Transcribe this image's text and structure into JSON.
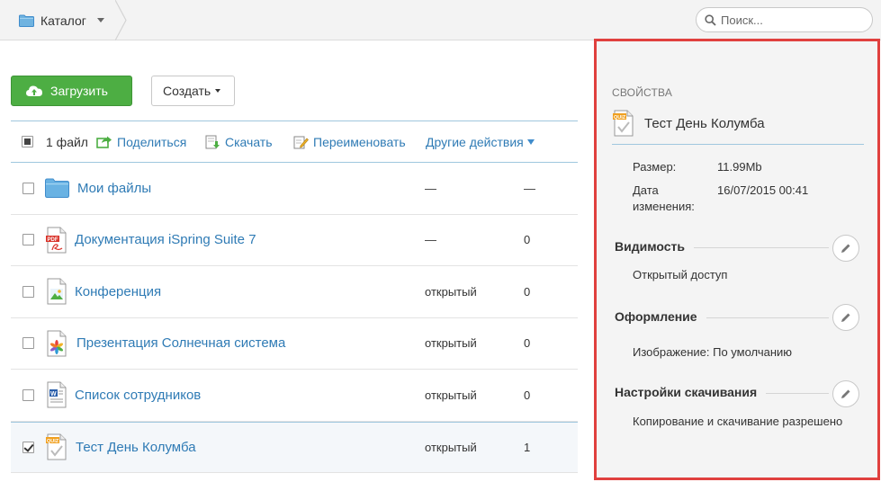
{
  "header": {
    "breadcrumb_label": "Каталог",
    "search_placeholder": "Поиск..."
  },
  "toolbar": {
    "upload_label": "Загрузить",
    "create_label": "Создать"
  },
  "list_header": {
    "count_label": "1 файл",
    "share_label": "Поделиться",
    "download_label": "Скачать",
    "rename_label": "Переименовать",
    "other_label": "Другие действия"
  },
  "files": [
    {
      "name": "Мои файлы",
      "type": "folder",
      "access": "—",
      "views": "—",
      "checked": false
    },
    {
      "name": "Документация iSpring Suite 7",
      "type": "pdf",
      "access": "—",
      "views": "0",
      "checked": false
    },
    {
      "name": "Конференция",
      "type": "image",
      "access": "открытый",
      "views": "0",
      "checked": false
    },
    {
      "name": "Презентация Солнечная система",
      "type": "presentation",
      "access": "открытый",
      "views": "0",
      "checked": false
    },
    {
      "name": "Список сотрудников",
      "type": "word",
      "access": "открытый",
      "views": "0",
      "checked": false
    },
    {
      "name": "Тест День Колумба",
      "type": "quiz",
      "access": "открытый",
      "views": "1",
      "checked": true
    }
  ],
  "properties": {
    "title": "СВОЙСТВА",
    "file_name": "Тест День Колумба",
    "size_label": "Размер:",
    "size_value": "11.99Mb",
    "modified_label": "Дата изменения:",
    "modified_value": "16/07/2015 00:41",
    "visibility_title": "Видимость",
    "visibility_value": "Открытый доступ",
    "design_title": "Оформление",
    "design_value": "Изображение: По умолчанию",
    "download_title": "Настройки скачивания",
    "download_value": "Копирование и скачивание разрешено"
  },
  "colors": {
    "accent_link": "#2f7bb5",
    "upload_green": "#4dae43",
    "panel_highlight": "#e0403e"
  }
}
